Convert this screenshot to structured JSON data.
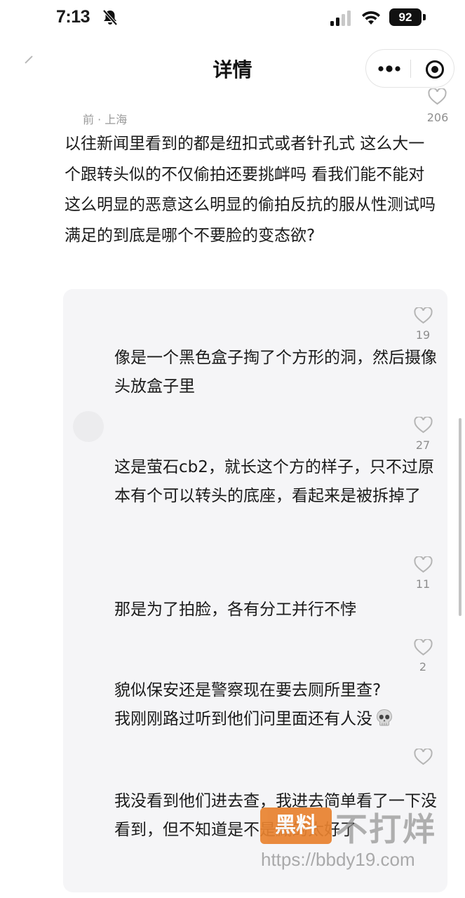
{
  "status_bar": {
    "time": "7:13",
    "battery": "92",
    "icons": [
      "bell-slash-icon",
      "signal-icon",
      "wifi-icon",
      "battery-icon"
    ]
  },
  "nav": {
    "title": "详情",
    "icons": [
      "back-icon",
      "more-icon",
      "target-icon"
    ]
  },
  "post": {
    "meta": "前 · 上海",
    "like_count": "206",
    "text": "以往新闻里看到的都是纽扣式或者针孔式 这么大一个跟转头似的不仅偷拍还要挑衅吗 看我们能不能对这么明显的恶意这么明显的偷拍反抗的服从性测试吗 满足的到底是哪个不要脸的变态欲?"
  },
  "replies": [
    {
      "like_count": "19",
      "text": "像是一个黑色盒子掏了个方形的洞，然后摄像头放盒子里"
    },
    {
      "like_count": "27",
      "text": "这是萤石cb2，就长这个方的样子，只不过原本有个可以转头的底座，看起来是被拆掉了"
    },
    {
      "like_count": "11",
      "text": "那是为了拍脸，各有分工并行不悖"
    },
    {
      "like_count": "2",
      "text_line1": "貌似保安还是警察现在要去厕所里查?",
      "text_line2": "我刚刚路过听到他们问里面还有人没",
      "emoji": "skull-icon"
    },
    {
      "like_count": "",
      "text": "我没看到他们进去查，我进去简单看了一下没看到，但不知道是不是藏的太好了"
    }
  ],
  "watermark": {
    "logo": "黑料",
    "brand": "不打烊",
    "url": "https://bbdy19.com"
  },
  "colors": {
    "background": "#ffffff",
    "reply_panel": "#f5f5f7",
    "text": "#1a1a1a",
    "muted": "#8e8e8e",
    "watermark_orange": "#e8822f"
  }
}
